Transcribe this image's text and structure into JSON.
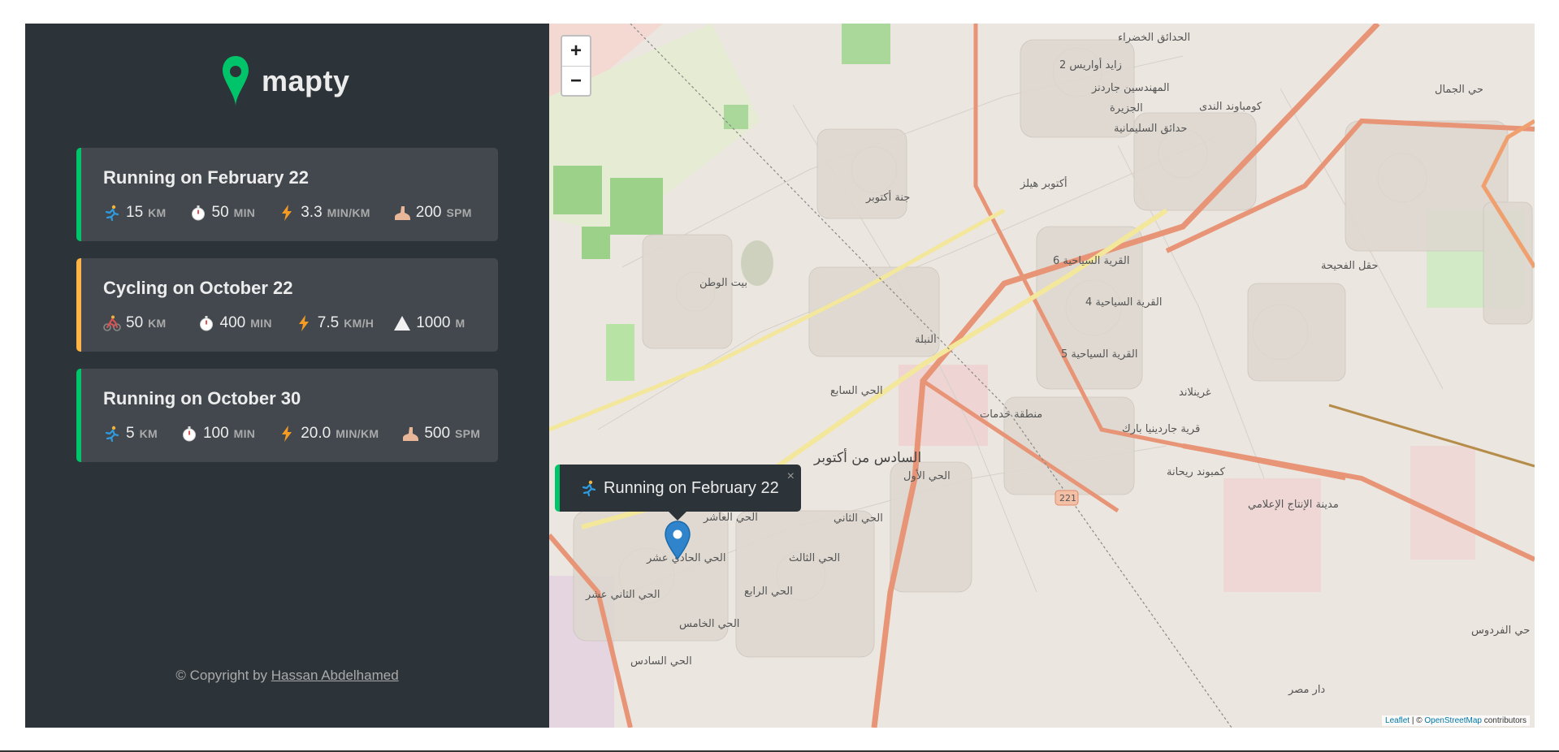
{
  "app": {
    "logo_text": "mapty"
  },
  "workouts": [
    {
      "type": "running",
      "color": "#00c46a",
      "title": "Running on February 22",
      "details": [
        {
          "icon": "runner-icon",
          "value": "15",
          "unit": "KM"
        },
        {
          "icon": "stopwatch-icon",
          "value": "50",
          "unit": "MIN"
        },
        {
          "icon": "lightning-icon",
          "value": "3.3",
          "unit": "MIN/KM"
        },
        {
          "icon": "foot-icon",
          "value": "200",
          "unit": "SPM"
        }
      ]
    },
    {
      "type": "cycling",
      "color": "#ffb545",
      "title": "Cycling on October 22",
      "details": [
        {
          "icon": "cyclist-icon",
          "value": "50",
          "unit": "KM"
        },
        {
          "icon": "stopwatch-icon",
          "value": "400",
          "unit": "MIN"
        },
        {
          "icon": "lightning-icon",
          "value": "7.5",
          "unit": "KM/H"
        },
        {
          "icon": "mountain-icon",
          "value": "1000",
          "unit": "M"
        }
      ]
    },
    {
      "type": "running",
      "color": "#00c46a",
      "title": "Running on October 30",
      "details": [
        {
          "icon": "runner-icon",
          "value": "5",
          "unit": "KM"
        },
        {
          "icon": "stopwatch-icon",
          "value": "100",
          "unit": "MIN"
        },
        {
          "icon": "lightning-icon",
          "value": "20.0",
          "unit": "MIN/KM"
        },
        {
          "icon": "foot-icon",
          "value": "500",
          "unit": "SPM"
        }
      ]
    }
  ],
  "copyright": {
    "prefix": "© Copyright by",
    "author": "Hassan Abdelhamed"
  },
  "map": {
    "zoom_in": "+",
    "zoom_out": "−",
    "popup_text": "Running on February 22",
    "popup_close": "×",
    "attribution": {
      "leaflet": "Leaflet",
      "sep": " | © ",
      "osm": "OpenStreetMap",
      "suffix": " contributors"
    },
    "labels": [
      "الحدائق الخضراء",
      "زايد أواريس 2",
      "المهندسين جاردنز",
      "الجزيرة",
      "حدائق السليمانية",
      "كومباوند الندى",
      "حي الجمال",
      "أكتوبر هيلز",
      "جنة أكتوبر",
      "بيت الوطن",
      "القرية السياحية 6",
      "القرية السياحية 4",
      "القرية السياحية 5",
      "غرينلاند",
      "قرية جاردينيا بارك",
      "كمبوند ريحانة",
      "منطقة خدمات",
      "الحي السابع",
      "السادس من أكتوبر",
      "الحي الأول",
      "الحي العاشر",
      "الحي الثاني",
      "الحي الحادي عشر",
      "الحي الثالث",
      "الحي الثاني عشر",
      "الحي الرابع",
      "الحي الخامس",
      "الحي السادس",
      "مدينة الإنتاج الإعلامي",
      "حي الفردوس",
      "حقل الفحيحة",
      "221",
      "دار مصر",
      "النبلة"
    ]
  }
}
